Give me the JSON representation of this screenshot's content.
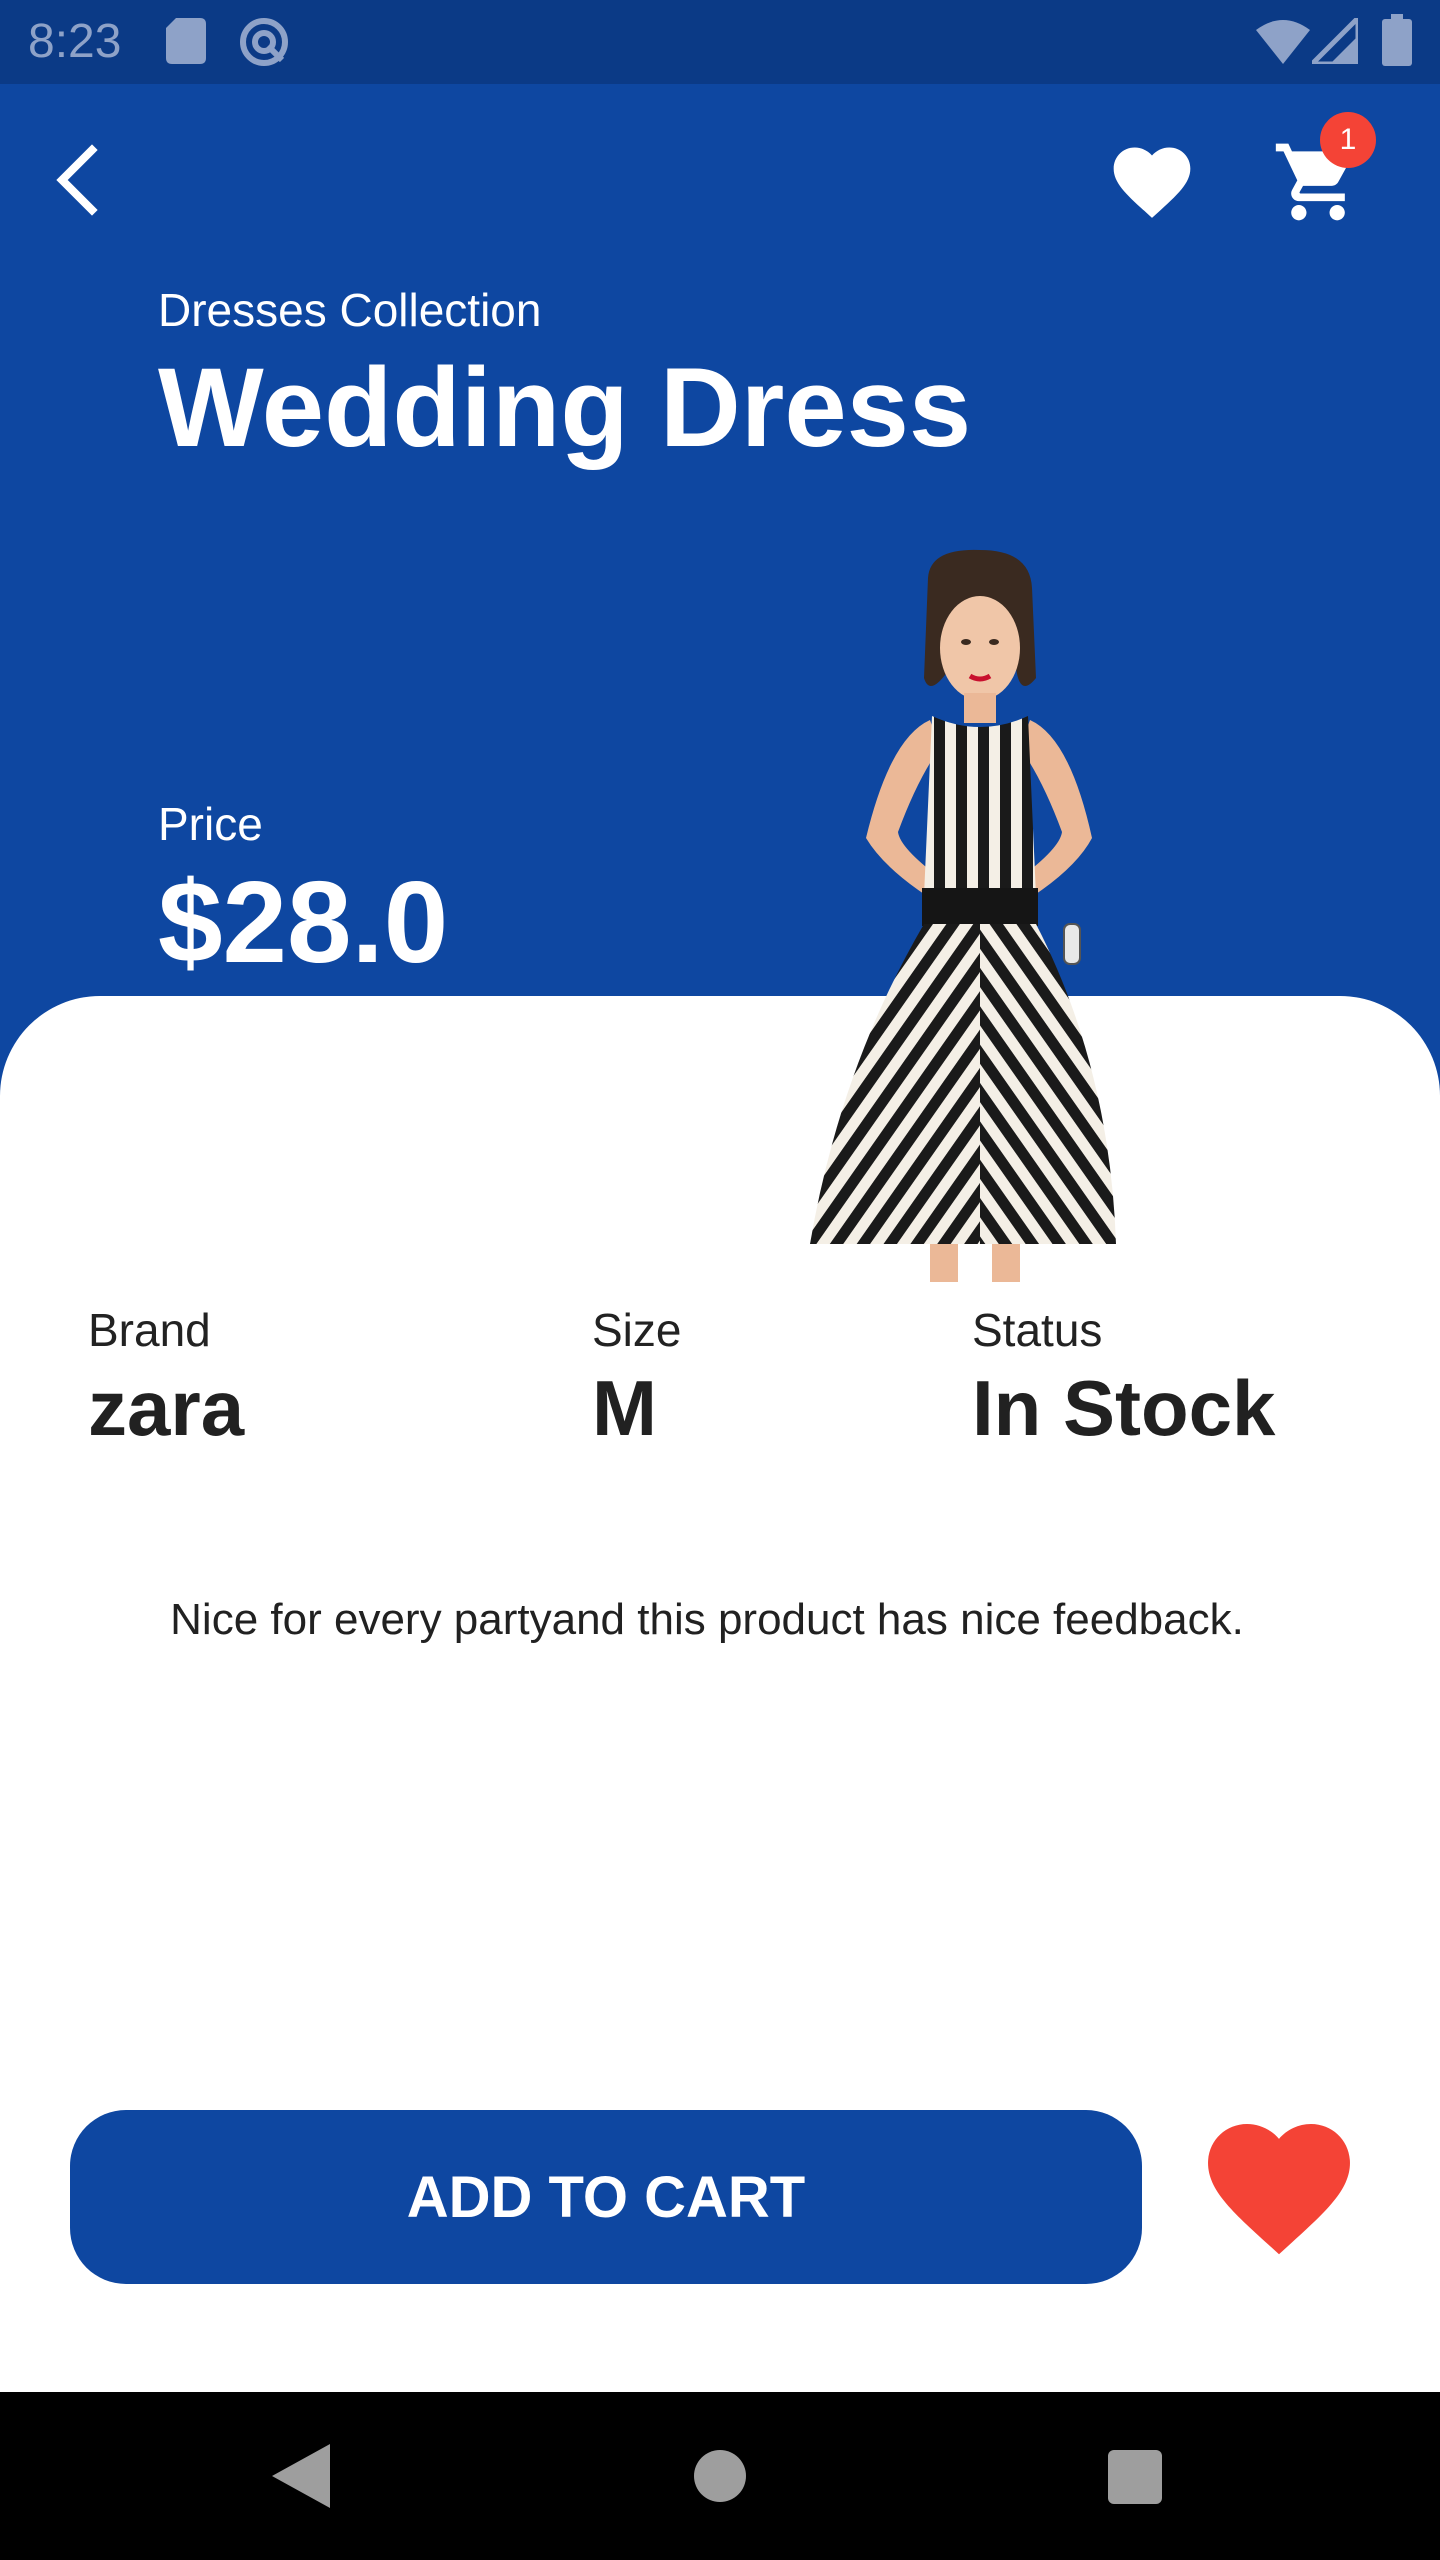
{
  "status_bar": {
    "time": "8:23",
    "icons": [
      "sd-card-icon",
      "sync-icon",
      "wifi-icon",
      "signal-icon",
      "battery-icon"
    ]
  },
  "header": {
    "back_icon": "back-arrow-icon",
    "favorite_icon": "heart-icon",
    "cart_icon": "cart-icon",
    "cart_count": "1"
  },
  "product": {
    "collection": "Dresses Collection",
    "name": "Wedding Dress",
    "price_label": "Price",
    "price": "$28.0",
    "image": "striped-dress-model"
  },
  "specs": [
    {
      "label": "Brand",
      "value": "zara"
    },
    {
      "label": "Size",
      "value": "M"
    },
    {
      "label": "Status",
      "value": "In Stock"
    }
  ],
  "description": "Nice for every partyand this product has nice feedback.",
  "actions": {
    "add_to_cart": "ADD TO CART",
    "favorite_icon": "heart-icon"
  },
  "colors": {
    "primary": "#0e47a1",
    "status_bar": "#0b3a86",
    "accent_red": "#f44336",
    "text_dark": "#212121"
  },
  "nav_bar": {
    "icons": [
      "nav-back-icon",
      "nav-home-icon",
      "nav-recents-icon"
    ]
  }
}
